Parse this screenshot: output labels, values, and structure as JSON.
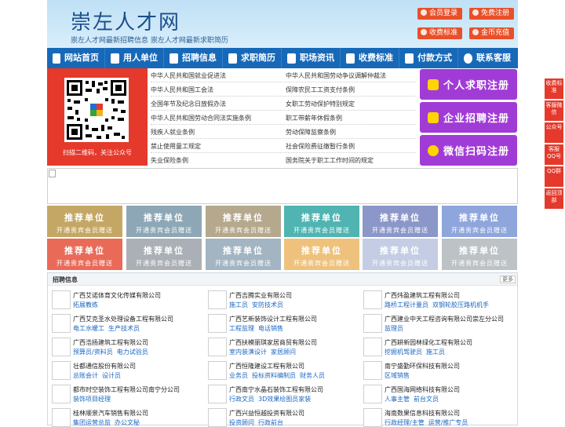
{
  "header": {
    "site_title": "崇左人才网",
    "subtitle": "崇左人才网最新招聘信息   崇左人才网最新求职简历",
    "buttons": [
      {
        "label": "会员登录",
        "color": "#e9502a"
      },
      {
        "label": "免费注册",
        "color": "#e9502a"
      },
      {
        "label": "收费标准",
        "color": "#e9502a"
      },
      {
        "label": "金币充值",
        "color": "#e9502a"
      }
    ]
  },
  "nav": [
    {
      "label": "网站首页",
      "icon": "home-icon"
    },
    {
      "label": "用人单位",
      "icon": "building-icon"
    },
    {
      "label": "招聘信息",
      "icon": "bullhorn-icon"
    },
    {
      "label": "求职简历",
      "icon": "resume-icon"
    },
    {
      "label": "职场资讯",
      "icon": "news-icon"
    },
    {
      "label": "收费标准",
      "icon": "shop-icon"
    },
    {
      "label": "付款方式",
      "icon": "payment-icon"
    },
    {
      "label": "联系客服",
      "icon": "phone-icon"
    }
  ],
  "qr": {
    "caption": "扫描二维码，关注公众号"
  },
  "links": {
    "left": [
      "中华人民共和国就业促进法",
      "中华人民共和国工会法",
      "全国年节及纪念日放假办法",
      "中华人民共和国劳动合同法实施条例",
      "残疾人就业条例",
      "禁止使用童工规定",
      "失业保险条例"
    ],
    "right": [
      "中华人民共和国劳动争议调解仲裁法",
      "保障农民工工资支付条例",
      "女职工劳动保护特别规定",
      "职工带薪年休假条例",
      "劳动保障监察条例",
      "社会保险费征缴暂行条例",
      "国务院关于职工工作时间的规定"
    ]
  },
  "register_buttons": [
    {
      "label": "个人求职注册",
      "icon": "person-icon"
    },
    {
      "label": "企业招聘注册",
      "icon": "company-icon"
    },
    {
      "label": "微信扫码注册",
      "icon": "wechat-icon"
    }
  ],
  "float_bar": [
    "收费标准",
    "客服微信",
    "公众号",
    "客服QQ号",
    "QQ群",
    "返回顶部"
  ],
  "recommend": {
    "line1": "推荐单位",
    "line2": "开通贵宾会员赠送",
    "colors": [
      "#c4a765",
      "#8ea7b6",
      "#b5a88d",
      "#4fb4b2",
      "#8c97c9",
      "#8ea6dc",
      "#ea6a58",
      "#aab0b6",
      "#a3b4c2",
      "#eec27d",
      "#c4cde3",
      "#bcc2c6"
    ]
  },
  "jobs": {
    "title": "招聘信息",
    "more": "更多",
    "columns": [
      [
        {
          "company": "广西艾诺体育文化传媒有限公司",
          "jobs": [
            "拓展教练"
          ]
        },
        {
          "company": "广西艾克圣水处理设备工程有限公司",
          "jobs": [
            "电工水暖工",
            "生产技术员"
          ]
        },
        {
          "company": "广西浩扬建筑工程有限公司",
          "jobs": [
            "预算员/资料员",
            "电力试验员"
          ]
        },
        {
          "company": "壮都通信股份有限公司",
          "jobs": [
            "总账会计",
            "设计员"
          ]
        },
        {
          "company": "都市时空装饰工程有限公司南宁分公司",
          "jobs": [
            "装饰项目经理"
          ]
        },
        {
          "company": "桂林顺景汽车销售有限公司",
          "jobs": [
            "集团运营总监",
            "办公文秘"
          ]
        }
      ],
      [
        {
          "company": "广西吉腾实业有限公司",
          "jobs": [
            "施工员",
            "安防技术员"
          ]
        },
        {
          "company": "广西艺新装饰设计工程有限公司",
          "jobs": [
            "工程监理",
            "电话销售"
          ]
        },
        {
          "company": "广西扶模丽琪家居商贸有限公司",
          "jobs": [
            "室内装潢设计",
            "家居顾问"
          ]
        },
        {
          "company": "广西恒隆建设工程有限公司",
          "jobs": [
            "业务员",
            "投标资料编制员",
            "财务人员"
          ]
        },
        {
          "company": "广西南宁水晶石装饰工程有限公司",
          "jobs": [
            "行政文员",
            "3D效果绘图员家装"
          ]
        },
        {
          "company": "广西兴益恒越投资有限公司",
          "jobs": [
            "投资顾问",
            "行政前台"
          ]
        }
      ],
      [
        {
          "company": "广西炜盈建筑工程有限公司",
          "jobs": [
            "路桥工程计量员",
            "双钢轮胶压路机机手"
          ]
        },
        {
          "company": "广西建业中天工程咨询有限公司崇左分公司",
          "jobs": [
            "监理员"
          ]
        },
        {
          "company": "广西耕新园林绿化工程有限公司",
          "jobs": [
            "挖掘机驾驶员",
            "施工员"
          ]
        },
        {
          "company": "南宁盛勤环保科技有限公司",
          "jobs": [
            "区域销售"
          ]
        },
        {
          "company": "广西国海网络科技有限公司",
          "jobs": [
            "人事主管",
            "前台文员"
          ]
        },
        {
          "company": "海南数果信息科技有限公司",
          "jobs": [
            "行政经理/主管",
            "运营/推广专员"
          ]
        }
      ]
    ]
  }
}
